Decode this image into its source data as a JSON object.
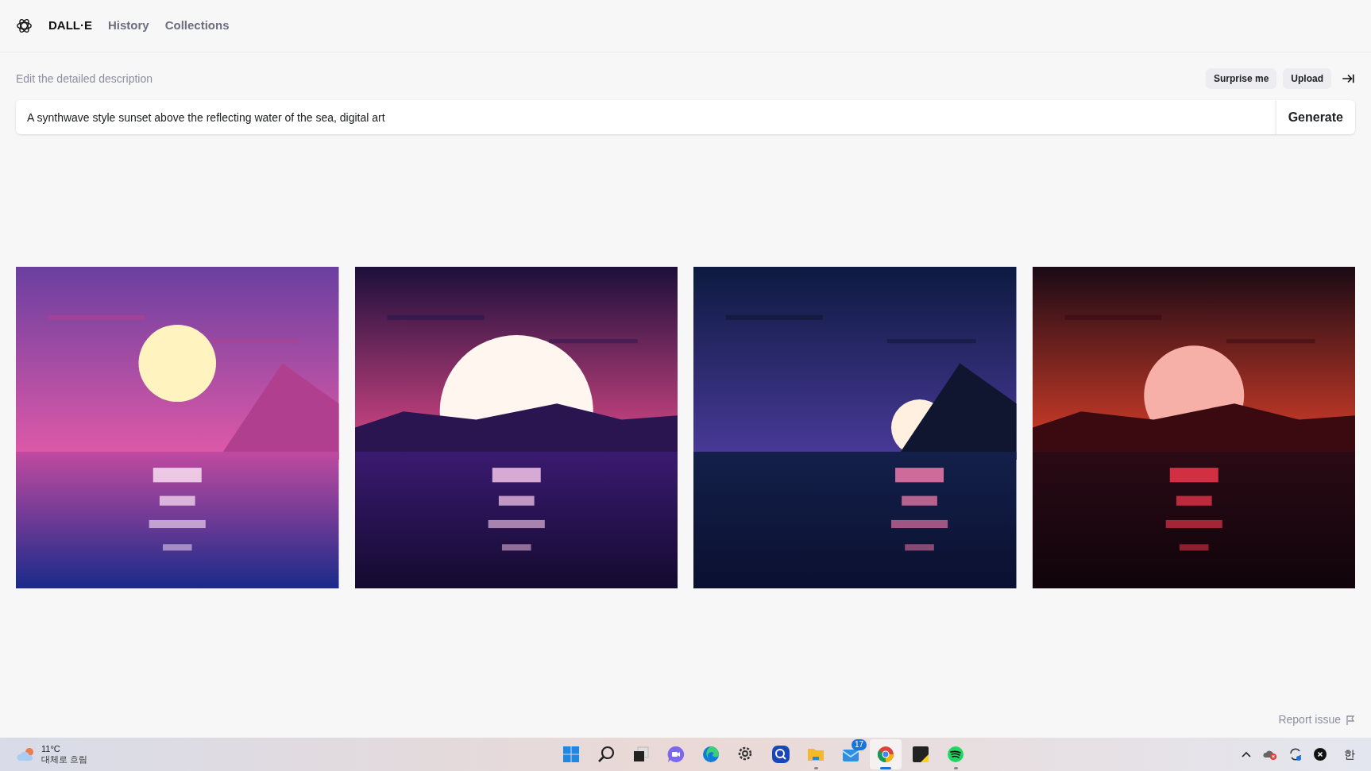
{
  "nav": {
    "brand": "DALL·E",
    "links": [
      {
        "label": "History"
      },
      {
        "label": "Collections"
      }
    ]
  },
  "prompt": {
    "label": "Edit the detailed description",
    "buttons": [
      "Surprise me",
      "Upload"
    ],
    "value": "A synthwave style sunset above the reflecting water of the sea, digital art",
    "submit": "Generate"
  },
  "report": "Report issue",
  "taskbar": {
    "weather": {
      "temp": "11°C",
      "condition": "대체로 흐림"
    },
    "apps": [
      {
        "kind": "start",
        "selected": false,
        "running": false
      },
      {
        "kind": "search",
        "selected": false,
        "running": false
      },
      {
        "kind": "taskview",
        "selected": false,
        "running": false
      },
      {
        "kind": "chat",
        "selected": false,
        "running": false
      },
      {
        "kind": "edge",
        "selected": false,
        "running": false
      },
      {
        "kind": "settings",
        "selected": false,
        "running": false
      },
      {
        "kind": "finder",
        "selected": false,
        "running": false
      },
      {
        "kind": "folder",
        "selected": false,
        "running": true
      },
      {
        "kind": "mail",
        "selected": false,
        "running": false,
        "badge": "17"
      },
      {
        "kind": "chrome",
        "selected": true,
        "running": true
      },
      {
        "kind": "notes",
        "selected": false,
        "running": false
      },
      {
        "kind": "music",
        "selected": false,
        "running": true
      }
    ],
    "ime": "한"
  }
}
